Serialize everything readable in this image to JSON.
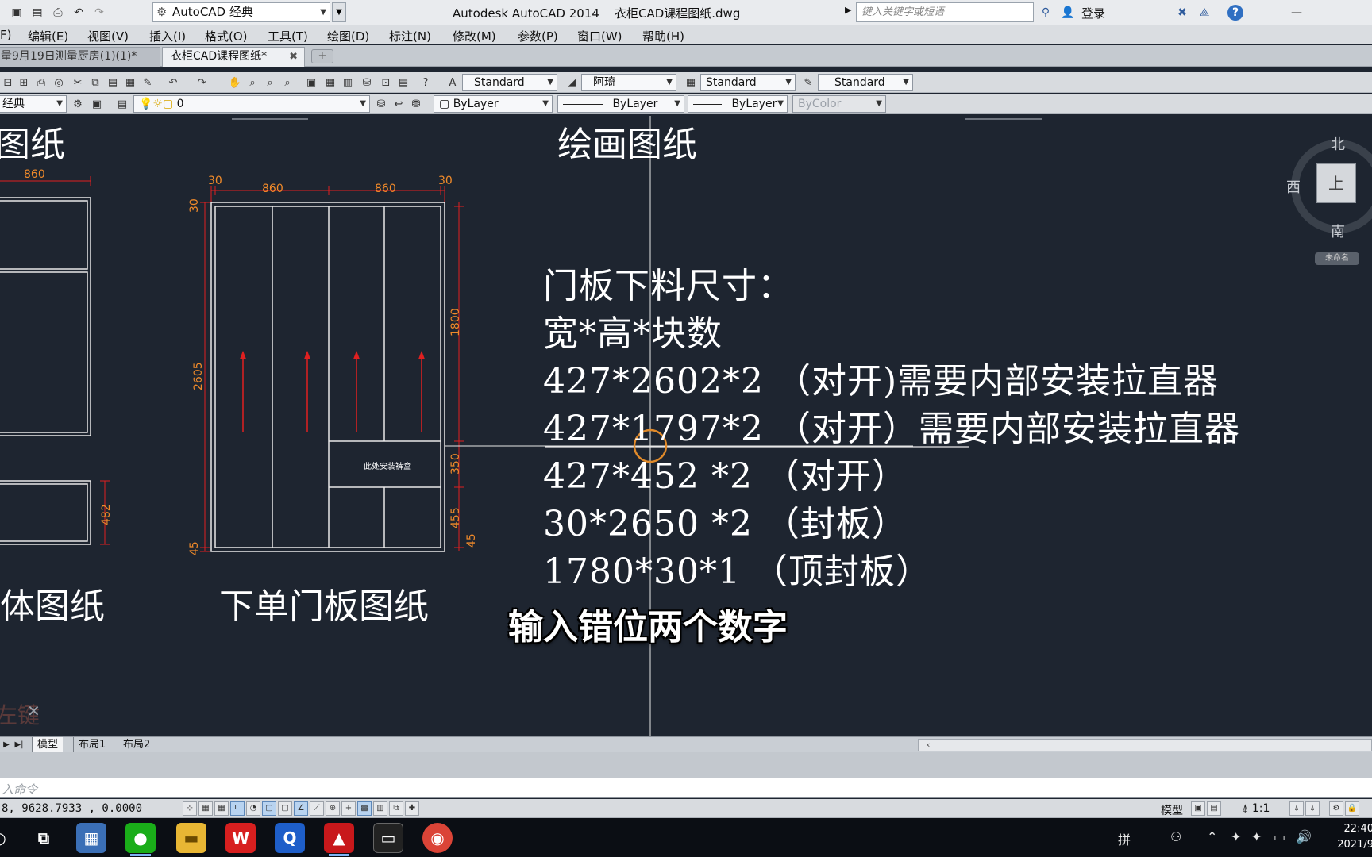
{
  "titlebar": {
    "workspace": "AutoCAD 经典",
    "app_title": "Autodesk AutoCAD 2014    衣柜CAD课程图纸.dwg",
    "search_placeholder": "键入关键字或短语",
    "login": "登录"
  },
  "menu": [
    "F)",
    "编辑(E)",
    "视图(V)",
    "插入(I)",
    "格式(O)",
    "工具(T)",
    "绘图(D)",
    "标注(N)",
    "修改(M)",
    "参数(P)",
    "窗口(W)",
    "帮助(H)"
  ],
  "tabs": {
    "inactive": "量9月19日测量厨房(1)(1)*",
    "active": "衣柜CAD课程图纸*"
  },
  "styles_toolbar": {
    "text_style": "Standard",
    "dim_style": "阿琦",
    "table_style": "Standard",
    "mleader_style": "Standard"
  },
  "layers_toolbar": {
    "workspace": "经典",
    "layer": "0",
    "color": "ByLayer",
    "linetype": "ByLayer",
    "lineweight": "ByLayer",
    "plotstyle": "ByColor"
  },
  "drawing": {
    "heading_left": "图纸",
    "heading_center": "绘画图纸",
    "label_cabinet": "柜体图纸",
    "label_door": "下单门板图纸",
    "note_lines": [
      "门板下料尺寸：",
      "宽*高*块数",
      "427*2602*2 （对开)需要内部安装拉直器",
      "427*1797*2 （对开）需要内部安装拉直器",
      "427*452 *2 （对开）",
      "30*2650 *2  （封板）",
      "1780*30*1    （顶封板）"
    ],
    "dims": {
      "left_860": "860",
      "top_30_left": "30",
      "top_860_a": "860",
      "top_860_b": "860",
      "top_30_right": "30",
      "side_30": "30",
      "side_2605": "2605",
      "side_45": "45",
      "right_1800": "1800",
      "right_350": "350",
      "right_455": "455",
      "right_45": "45",
      "left_482": "482"
    },
    "box_label": "此处安装裤盒",
    "faded_text": "左键"
  },
  "viewcube": {
    "north": "北",
    "west": "西",
    "south": "南",
    "face": "上",
    "wcs": "未命名"
  },
  "subtitle": "输入错位两个数字",
  "layout_tabs": [
    "模型",
    "布局1",
    "布局2"
  ],
  "command": {
    "placeholder": "入命令"
  },
  "status": {
    "coords": "8, 9628.7933 , 0.0000",
    "model": "模型",
    "scale": "1:1"
  },
  "clock": {
    "time": "22:40",
    "date": "2021/9"
  },
  "colors": {
    "canvas": "#1e2530",
    "cad_line": "#ffffff",
    "dim_red": "#e02020",
    "dim_text": "#f08a2a"
  }
}
